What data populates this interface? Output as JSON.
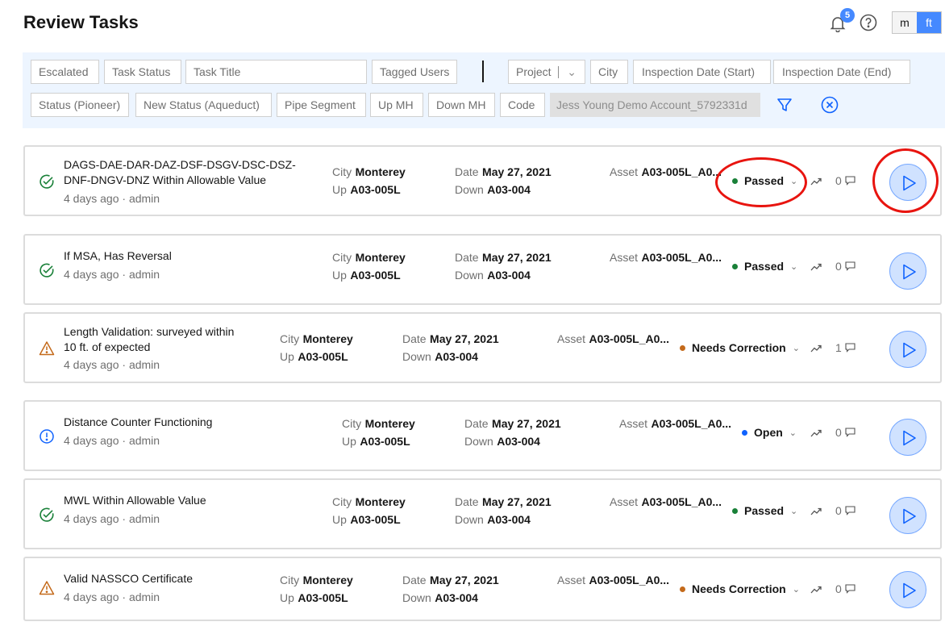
{
  "header": {
    "title": "Review Tasks",
    "notification_count": "5"
  },
  "units": {
    "m": "m",
    "ft": "ft"
  },
  "filters": {
    "escalated": "Escalated",
    "task_status": "Task Status",
    "task_title": "Task Title",
    "tagged_users": "Tagged Users",
    "project": "Project",
    "city": "City",
    "inspection_start": "Inspection Date (Start)",
    "inspection_end": "Inspection Date (End)",
    "status_pioneer": "Status (Pioneer)",
    "new_status_aqueduct": "New Status (Aqueduct)",
    "pipe_segment": "Pipe Segment",
    "up_mh": "Up MH",
    "down_mh": "Down MH",
    "code": "Code",
    "account": "Jess Young Demo Account_5792331d"
  },
  "labels": {
    "city": "City",
    "up": "Up",
    "date": "Date",
    "down": "Down",
    "asset": "Asset"
  },
  "tasks": [
    {
      "title": "DAGS-DAE-DAR-DAZ-DSF-DSGV-DSC-DSZ-DNF-DNGV-DNZ Within Allowable Value",
      "meta": "4 days ago · admin",
      "city": "Monterey",
      "up": "A03-005L",
      "date": "May 27, 2021",
      "down": "A03-004",
      "asset": "A03-005L_A0...",
      "status": "Passed",
      "comments": "0",
      "icon": "check-circle-icon"
    },
    {
      "title": "If MSA, Has Reversal",
      "meta": "4 days ago · admin",
      "city": "Monterey",
      "up": "A03-005L",
      "date": "May 27, 2021",
      "down": "A03-004",
      "asset": "A03-005L_A0...",
      "status": "Passed",
      "comments": "0",
      "icon": "check-circle-icon"
    },
    {
      "title": "Length Validation: surveyed within 10 ft. of expected",
      "meta": "4 days ago · admin",
      "city": "Monterey",
      "up": "A03-005L",
      "date": "May 27, 2021",
      "down": "A03-004",
      "asset": "A03-005L_A0...",
      "status": "Needs Correction",
      "comments": "1",
      "icon": "warning-triangle-icon"
    },
    {
      "title": "Distance Counter Functioning",
      "meta": "4 days ago · admin",
      "city": "Monterey",
      "up": "A03-005L",
      "date": "May 27, 2021",
      "down": "A03-004",
      "asset": "A03-005L_A0...",
      "status": "Open",
      "comments": "0",
      "icon": "info-circle-icon"
    },
    {
      "title": "MWL Within Allowable Value",
      "meta": "4 days ago · admin",
      "city": "Monterey",
      "up": "A03-005L",
      "date": "May 27, 2021",
      "down": "A03-004",
      "asset": "A03-005L_A0...",
      "status": "Passed",
      "comments": "0",
      "icon": "check-circle-icon"
    },
    {
      "title": "Valid NASSCO Certificate",
      "meta": "4 days ago · admin",
      "city": "Monterey",
      "up": "A03-005L",
      "date": "May 27, 2021",
      "down": "A03-004",
      "asset": "A03-005L_A0...",
      "status": "Needs Correction",
      "comments": "0",
      "icon": "warning-triangle-icon"
    }
  ],
  "colors": {
    "passed": "#198038",
    "needs_correction": "#c46a1b",
    "open": "#0f62fe",
    "accent": "#4589ff",
    "annotation": "#e8140f"
  }
}
